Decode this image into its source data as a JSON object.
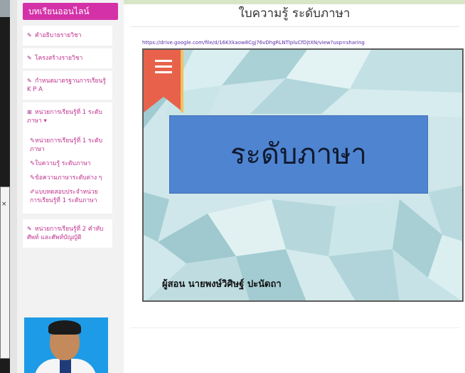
{
  "sidebar": {
    "header": "บทเรียนออนไลน์",
    "items": [
      {
        "label": "คำอธิบายรายวิชา",
        "icon": "pencil-icon"
      },
      {
        "label": "โครงสร้างรายวิชา",
        "icon": "pencil-icon"
      },
      {
        "label": "กำหนดมาตรฐานการเรียนรู้ K P A",
        "icon": "pencil-icon"
      },
      {
        "label": "หน่วยการเรียนรู้ที่ 1 ระดับภาษา ▾",
        "icon": "plus-square-icon"
      }
    ],
    "submenu": [
      {
        "label": "หน่วยการเรียนรู้ที่ 1 ระดับภาษา",
        "icon": "pencil-icon"
      },
      {
        "label": "ใบความรู้ ระดับภาษา",
        "icon": "pencil-icon"
      },
      {
        "label": "ข้อความภาษาระดับต่าง ๆ",
        "icon": "pencil-icon"
      },
      {
        "label": "แบบทดสอบประจำหน่วยการเรียนรู้ที่ 1 ระดับภาษา",
        "icon": "edit-icon"
      }
    ],
    "unit2": {
      "label": "หน่วยการเรียนรู้ที่ 2 คำทับศัพท์ และศัพท์บัญญัติ",
      "icon": "pencil-icon"
    }
  },
  "main": {
    "title": "ใบความรู้ ระดับภาษา",
    "link": "https://drive.google.com/file/d/16KXkaow8Cgj76vDhgRLNTlpluCfDjtXN/view?usp=sharing",
    "slide_title": "ระดับภาษา",
    "teacher": "ผู้สอน  นายพงษ์วิศิษฐ์  ปะนัดถา"
  },
  "colors": {
    "sidebar_header": "#d431a8",
    "menu_text": "#c0328f",
    "banner": "#4f84d1",
    "bookmark": "#e85d4a"
  }
}
